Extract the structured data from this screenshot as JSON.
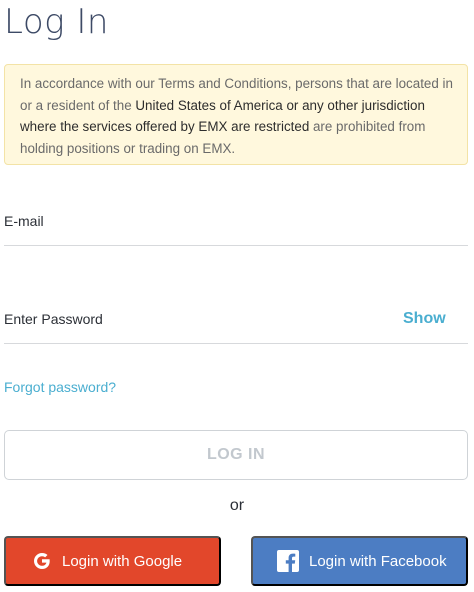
{
  "page": {
    "title": "Log In"
  },
  "notice": {
    "part1": "In accordance with our Terms and Conditions, persons that are located in or a resident of the ",
    "part2": "United States of America or any other jurisdiction where the services offered by EMX are restricted",
    "part3": " are prohibited from holding positions or trading on EMX."
  },
  "form": {
    "email_label": "E-mail",
    "password_label": "Enter Password",
    "show_label": "Show",
    "forgot_label": "Forgot password?",
    "login_label": "LOG IN",
    "or_label": "or"
  },
  "social": {
    "google_label": "Login with Google",
    "google_icon": "google-g-icon",
    "facebook_label": "Login with Facebook",
    "facebook_icon": "facebook-f-icon"
  },
  "colors": {
    "accent": "#4aaed0",
    "google": "#e2472b",
    "facebook": "#4c7dc3",
    "notice_bg": "#fff8dd"
  }
}
